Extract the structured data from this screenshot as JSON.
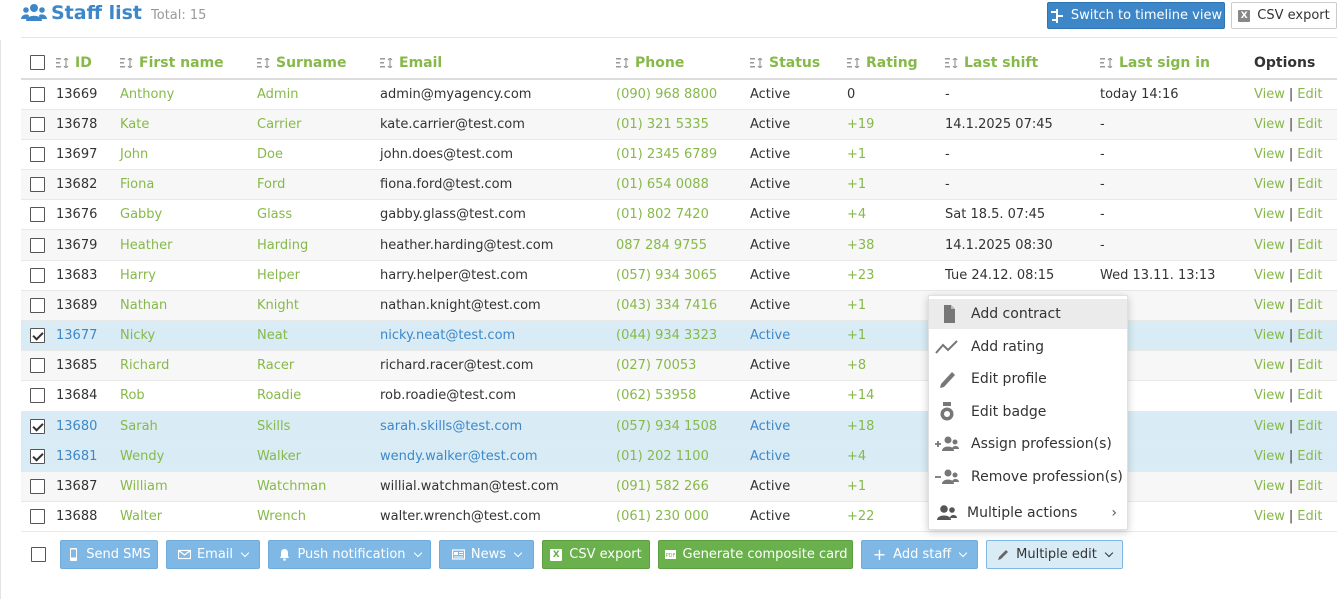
{
  "header": {
    "title": "Staff list",
    "total": "Total: 15",
    "timeline_button": "Switch to timeline view",
    "csv_button": "CSV export"
  },
  "table": {
    "columns": {
      "id": "ID",
      "first": "First name",
      "surname": "Surname",
      "email": "Email",
      "phone": "Phone",
      "status": "Status",
      "rating": "Rating",
      "last_shift": "Last shift",
      "last_sign_in": "Last sign in",
      "options": "Options"
    },
    "view_label": "View",
    "edit_label": "Edit",
    "rows": [
      {
        "id": "13669",
        "first": "Anthony",
        "surname": "Admin",
        "email": "admin@myagency.com",
        "phone": "(090) 968 8800",
        "status": "Active",
        "rating": "0",
        "last_shift": "-",
        "last_sign_in": "today 14:16",
        "selected": false
      },
      {
        "id": "13678",
        "first": "Kate",
        "surname": "Carrier",
        "email": "kate.carrier@test.com",
        "phone": "(01) 321 5335",
        "status": "Active",
        "rating": "+19",
        "last_shift": "14.1.2025 07:45",
        "last_sign_in": "-",
        "selected": false
      },
      {
        "id": "13697",
        "first": "John",
        "surname": "Doe",
        "email": "john.does@test.com",
        "phone": "(01) 2345 6789",
        "status": "Active",
        "rating": "+1",
        "last_shift": "-",
        "last_sign_in": "-",
        "selected": false
      },
      {
        "id": "13682",
        "first": "Fiona",
        "surname": "Ford",
        "email": "fiona.ford@test.com",
        "phone": "(01) 654 0088",
        "status": "Active",
        "rating": "+1",
        "last_shift": "-",
        "last_sign_in": "-",
        "selected": false
      },
      {
        "id": "13676",
        "first": "Gabby",
        "surname": "Glass",
        "email": "gabby.glass@test.com",
        "phone": "(01) 802 7420",
        "status": "Active",
        "rating": "+4",
        "last_shift": "Sat 18.5. 07:45",
        "last_sign_in": "-",
        "selected": false
      },
      {
        "id": "13679",
        "first": "Heather",
        "surname": "Harding",
        "email": "heather.harding@test.com",
        "phone": "087 284 9755",
        "status": "Active",
        "rating": "+38",
        "last_shift": "14.1.2025 08:30",
        "last_sign_in": "-",
        "selected": false
      },
      {
        "id": "13683",
        "first": "Harry",
        "surname": "Helper",
        "email": "harry.helper@test.com",
        "phone": "(057) 934 3065",
        "status": "Active",
        "rating": "+23",
        "last_shift": "Tue 24.12. 08:15",
        "last_sign_in": "Wed 13.11. 13:13",
        "selected": false
      },
      {
        "id": "13689",
        "first": "Nathan",
        "surname": "Knight",
        "email": "nathan.knight@test.com",
        "phone": "(043) 334 7416",
        "status": "Active",
        "rating": "+1",
        "last_shift": "",
        "last_sign_in": "",
        "selected": false
      },
      {
        "id": "13677",
        "first": "Nicky",
        "surname": "Neat",
        "email": "nicky.neat@test.com",
        "phone": "(044) 934 3323",
        "status": "Active",
        "rating": "+1",
        "last_shift": "",
        "last_sign_in": "",
        "selected": true
      },
      {
        "id": "13685",
        "first": "Richard",
        "surname": "Racer",
        "email": "richard.racer@test.com",
        "phone": "(027) 70053",
        "status": "Active",
        "rating": "+8",
        "last_shift": "",
        "last_sign_in": "",
        "selected": false
      },
      {
        "id": "13684",
        "first": "Rob",
        "surname": "Roadie",
        "email": "rob.roadie@test.com",
        "phone": "(062) 53958",
        "status": "Active",
        "rating": "+14",
        "last_shift": "",
        "last_sign_in": "",
        "selected": false
      },
      {
        "id": "13680",
        "first": "Sarah",
        "surname": "Skills",
        "email": "sarah.skills@test.com",
        "phone": "(057) 934 1508",
        "status": "Active",
        "rating": "+18",
        "last_shift": "",
        "last_sign_in": "",
        "selected": true
      },
      {
        "id": "13681",
        "first": "Wendy",
        "surname": "Walker",
        "email": "wendy.walker@test.com",
        "phone": "(01) 202 1100",
        "status": "Active",
        "rating": "+4",
        "last_shift": "",
        "last_sign_in": "",
        "selected": true
      },
      {
        "id": "13687",
        "first": "William",
        "surname": "Watchman",
        "email": "willial.watchman@test.com",
        "phone": "(091) 582 266",
        "status": "Active",
        "rating": "+1",
        "last_shift": "",
        "last_sign_in": "",
        "selected": false
      },
      {
        "id": "13688",
        "first": "Walter",
        "surname": "Wrench",
        "email": "walter.wrench@test.com",
        "phone": "(061) 230 000",
        "status": "Active",
        "rating": "+22",
        "last_shift": "",
        "last_sign_in": "",
        "selected": false
      }
    ]
  },
  "bottom": {
    "send_sms": "Send SMS",
    "email": "Email",
    "push": "Push notification",
    "news": "News",
    "csv": "CSV export",
    "composite": "Generate composite card",
    "add_staff": "Add staff",
    "multiple_edit": "Multiple edit"
  },
  "dropdown": {
    "add_contract": "Add contract",
    "add_rating": "Add rating",
    "edit_profile": "Edit profile",
    "edit_badge": "Edit badge",
    "assign_profession": "Assign profession(s)",
    "remove_profession": "Remove profession(s)",
    "multiple_actions": "Multiple actions"
  },
  "colors": {
    "primary_blue": "#3d87c9",
    "light_blue": "#7fb8e5",
    "green": "#86b94a",
    "button_green": "#6ab04c",
    "selected_row": "#d9ecf5"
  }
}
